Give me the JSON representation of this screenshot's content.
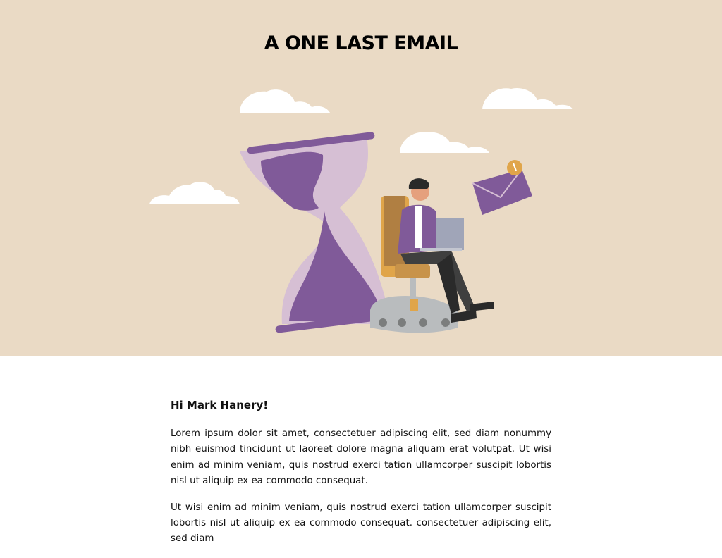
{
  "header": {
    "title": "A ONE LAST EMAIL"
  },
  "illustration": {
    "icon": "hourglass-person-laptop-email-illustration"
  },
  "body": {
    "greeting": "Hi Mark Hanery!",
    "paragraphs": [
      "Lorem ipsum dolor sit amet, consectetuer adipiscing elit, sed diam nonummy nibh euismod tincidunt ut laoreet dolore magna aliquam erat volutpat. Ut wisi enim ad minim veniam, quis nostrud exerci tation ullamcorper suscipit lobortis nisl ut aliquip ex ea commodo consequat.",
      "Ut wisi enim ad minim veniam, quis nostrud exerci tation ullamcorper suscipit lobortis nisl ut aliquip ex ea commodo consequat. consectetuer adipiscing elit, sed diam"
    ]
  },
  "colors": {
    "hero_bg": "#eadac5",
    "purple": "#805a99",
    "orange": "#e0a54a"
  }
}
